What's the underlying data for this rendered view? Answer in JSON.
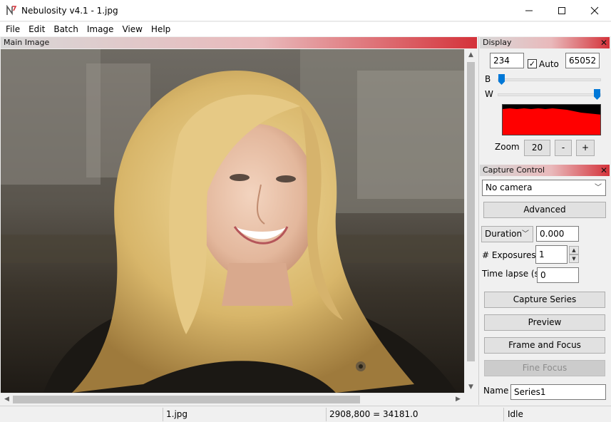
{
  "window": {
    "title": "Nebulosity v4.1 - 1.jpg"
  },
  "menu": [
    "File",
    "Edit",
    "Batch",
    "Image",
    "View",
    "Help"
  ],
  "main": {
    "header": "Main Image"
  },
  "display": {
    "header": "Display",
    "black_value": "234",
    "auto_label": "Auto",
    "auto_checked": "✓",
    "white_value": "65052",
    "b_label": "B",
    "w_label": "W",
    "black_slider_level": 0.0,
    "white_slider_level": 1.0,
    "zoom_label": "Zoom",
    "zoom_value": "20",
    "zoom_minus": "-",
    "zoom_plus": "+"
  },
  "capture": {
    "header": "Capture Control",
    "camera": "No camera",
    "advanced": "Advanced",
    "duration_mode": "Duration",
    "duration_value": "0.000",
    "exposures_label": "# Exposures",
    "exposures_value": "1",
    "timelapse_label": "Time lapse (s)",
    "timelapse_value": "0",
    "capture_series": "Capture Series",
    "preview": "Preview",
    "frame_focus": "Frame and Focus",
    "fine_focus": "Fine Focus",
    "name_label": "Name",
    "name_value": "Series1"
  },
  "status": {
    "file": "1.jpg",
    "pixel_info": "2908,800 = 34181.0",
    "state": "Idle"
  },
  "colors": {
    "accent_red": "#d4323a",
    "slider_blue": "#0078d7",
    "histogram_red": "#ff0000"
  },
  "icons": {
    "close": "close-icon",
    "minimize": "minimize-icon",
    "maximize": "maximize-icon",
    "chevron": "chevron-down-icon"
  }
}
